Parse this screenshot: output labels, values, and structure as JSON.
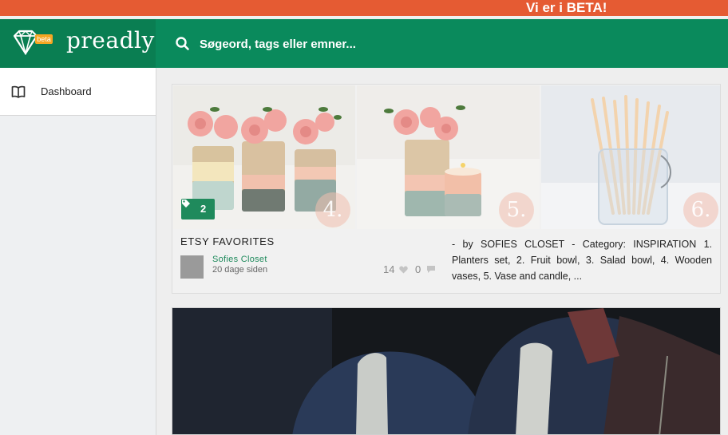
{
  "beta_banner": {
    "text": "Vi er i BETA!"
  },
  "header": {
    "logo_badge": "beta",
    "logo_text": "preadly",
    "search_placeholder": "Søgeord, tags eller emner..."
  },
  "sidebar": {
    "items": [
      {
        "label": "Dashboard",
        "icon": "book-icon"
      }
    ]
  },
  "feed": {
    "cards": [
      {
        "title": "ETSY FAVORITES",
        "tag_count": "2",
        "image_numbers": [
          "4.",
          "5.",
          "6."
        ],
        "author": "Sofies Closet",
        "date": "20 dage siden",
        "likes": "14",
        "comments": "0",
        "description": "- by SOFIES CLOSET - Category: INSPIRATION 1. Planters set, 2. Fruit bowl, 3. Salad bowl, 4. Wooden vases, 5. Vase and candle, ..."
      }
    ]
  },
  "colors": {
    "beta_bar": "#e55b33",
    "brand_green": "#0a8a5c",
    "accent_green": "#1f8a5c"
  }
}
